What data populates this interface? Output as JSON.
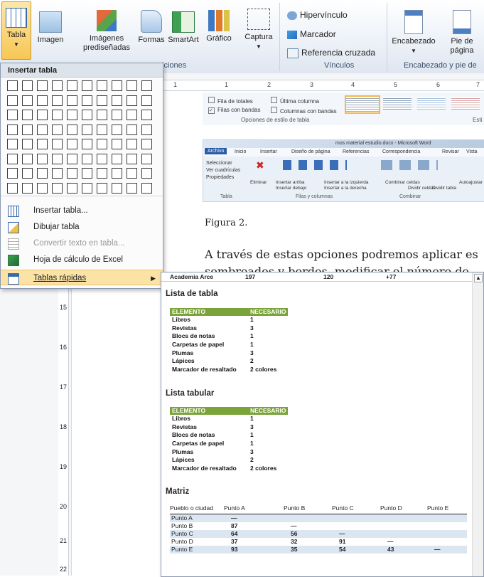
{
  "ribbon": {
    "buttons": [
      {
        "label": "Tabla",
        "sub": "",
        "icon": "table-icon"
      },
      {
        "label": "Imagen",
        "sub": "",
        "icon": "picture-icon"
      },
      {
        "label": "Imágenes",
        "sub": "prediseñadas",
        "icon": "clipart-icon"
      },
      {
        "label": "Formas",
        "sub": "",
        "icon": "shapes-icon"
      },
      {
        "label": "SmartArt",
        "sub": "",
        "icon": "smartart-icon"
      },
      {
        "label": "Gráfico",
        "sub": "",
        "icon": "chart-icon"
      },
      {
        "label": "Captura",
        "sub": "",
        "icon": "screenshot-icon"
      }
    ],
    "links": [
      "Hipervínculo",
      "Marcador",
      "Referencia cruzada"
    ],
    "header_buttons": [
      {
        "label": "Encabezado",
        "sub": ""
      },
      {
        "label": "Pie de",
        "sub": "página"
      }
    ],
    "groups": {
      "ilustraciones_partial": "iciones",
      "vinculos": "Vínculos",
      "encabezado": "Encabezado y pie de"
    }
  },
  "doc": {
    "ruler_marks": [
      "1",
      "1",
      "2",
      "3",
      "4",
      "5",
      "6",
      "7"
    ],
    "left_ruler": [
      "15",
      "16",
      "17",
      "18",
      "19",
      "20",
      "21",
      "22"
    ],
    "style_options": {
      "fila_totales": "Fila de totales",
      "ultima_columna": "Última columna",
      "filas_bandas": "Filas con bandas",
      "columnas_bandas": "Columnas con bandas",
      "group": "Opciones de estilo de tabla",
      "esti": "Esti"
    },
    "word_snip": {
      "title": "mos material estudio.docx - Microsoft Word",
      "tabs": [
        "Archivo",
        "Inicio",
        "Insertar",
        "Diseño de página",
        "Referencias",
        "Correspondencia",
        "Revisar",
        "Vista"
      ],
      "left_items": [
        "Seleccionar",
        "Ver cuadrículas",
        "Propiedades"
      ],
      "left_group": "Tabla",
      "tools": [
        "Eliminar",
        "Insertar arriba",
        "Insertar debajo",
        "Insertar a la izquierda",
        "Insertar a la derecha",
        "Combinar celdas",
        "Dividir celdas",
        "Dividir tabla",
        "Autoajustar"
      ],
      "groups": [
        "Filas y columnas",
        "Combinar"
      ]
    },
    "figura": "Figura 2.",
    "body_text": "A través de estas opciones podremos aplicar es",
    "body_text2": "sombreados y bordes, modificar el número de"
  },
  "menu": {
    "title": "Insertar tabla",
    "items": [
      {
        "label": "Insertar tabla...",
        "icon": "insert-table-icon",
        "disabled": false
      },
      {
        "label": "Dibujar tabla",
        "icon": "draw-table-icon",
        "disabled": false
      },
      {
        "label": "Convertir texto en tabla...",
        "icon": "convert-text-icon",
        "disabled": true
      },
      {
        "label": "Hoja de cálculo de Excel",
        "icon": "excel-icon",
        "disabled": false
      },
      {
        "label": "Tablas rápidas",
        "icon": "quick-tables-icon",
        "disabled": false,
        "highlighted": true
      }
    ]
  },
  "flyout": {
    "top_row": [
      "Academia Arce",
      "197",
      "120",
      "+77"
    ],
    "sections": {
      "lista_tabla": "Lista de tabla",
      "lista_tabular": "Lista tabular",
      "matriz": "Matriz"
    },
    "list_header": [
      "ELEMENTO",
      "NECESARIO"
    ],
    "list_rows": [
      [
        "Libros",
        "1"
      ],
      [
        "Revistas",
        "3"
      ],
      [
        "Blocs de notas",
        "1"
      ],
      [
        "Carpetas de papel",
        "1"
      ],
      [
        "Plumas",
        "3"
      ],
      [
        "Lápices",
        "2"
      ],
      [
        "Marcador de resaltado",
        "2 colores"
      ]
    ],
    "matrix_header": [
      "Pueblo o ciudad",
      "Punto A",
      "Punto B",
      "Punto C",
      "Punto D",
      "Punto E"
    ],
    "matrix_rows": [
      [
        "Punto A",
        "—",
        "",
        "",
        "",
        ""
      ],
      [
        "Punto B",
        "87",
        "—",
        "",
        "",
        ""
      ],
      [
        "Punto C",
        "64",
        "56",
        "—",
        "",
        ""
      ],
      [
        "Punto D",
        "37",
        "32",
        "91",
        "—",
        ""
      ],
      [
        "Punto E",
        "93",
        "35",
        "54",
        "43",
        "—"
      ]
    ]
  },
  "colors": {
    "list_header": "#7aa33a",
    "matrix_band": "#dce6f1",
    "highlight": "#fbe3a6"
  }
}
